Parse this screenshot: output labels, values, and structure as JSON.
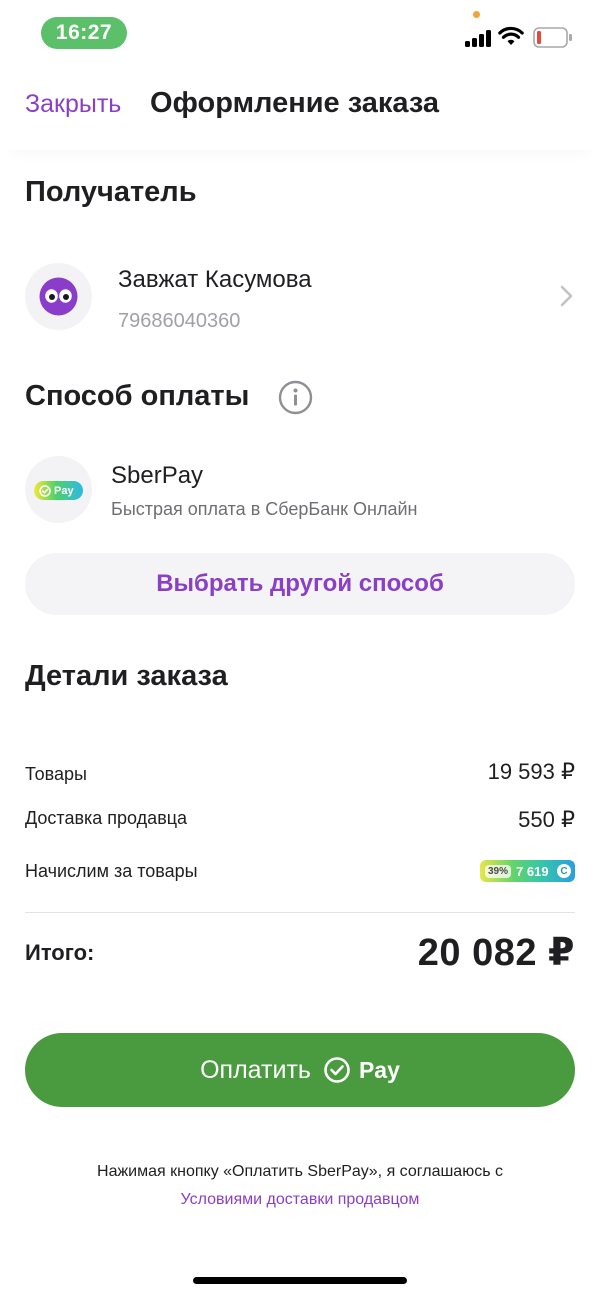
{
  "status_bar": {
    "time": "16:27"
  },
  "header": {
    "close_label": "Закрыть",
    "title": "Оформление заказа"
  },
  "recipient": {
    "section_title": "Получатель",
    "name": "Завжат Касумова",
    "phone": "79686040360"
  },
  "payment": {
    "section_title": "Способ оплаты",
    "method_name": "SberPay",
    "method_description": "Быстрая оплата в СберБанк Онлайн",
    "badge_text": "Pay",
    "other_method_button": "Выбрать другой способ"
  },
  "details": {
    "section_title": "Детали заказа",
    "rows": [
      {
        "label": "Товары",
        "value": "19 593 ₽"
      },
      {
        "label": "Доставка продавца",
        "value": "550 ₽"
      },
      {
        "label": "Начислим за товары",
        "bonus_percent": "39%",
        "bonus_amount": "7 619",
        "bonus_coin": "С"
      }
    ],
    "total_label": "Итого:",
    "total_value": "20 082 ₽"
  },
  "pay_button": {
    "label": "Оплатить",
    "suffix": "Pay"
  },
  "agreement": {
    "text": "Нажимая кнопку «Оплатить SberPay», я соглашаюсь с",
    "link": "Условиями доставки продавцом"
  },
  "colors": {
    "accent_purple": "#8b3fc4",
    "pay_green": "#4a9b3f",
    "time_pill_green": "#5cc06b",
    "battery_low_red": "#e5493a"
  },
  "icons": [
    "signal-icon",
    "wifi-icon",
    "battery-icon",
    "eyes-avatar-icon",
    "chevron-right-icon",
    "info-icon",
    "sberpay-check-icon"
  ]
}
